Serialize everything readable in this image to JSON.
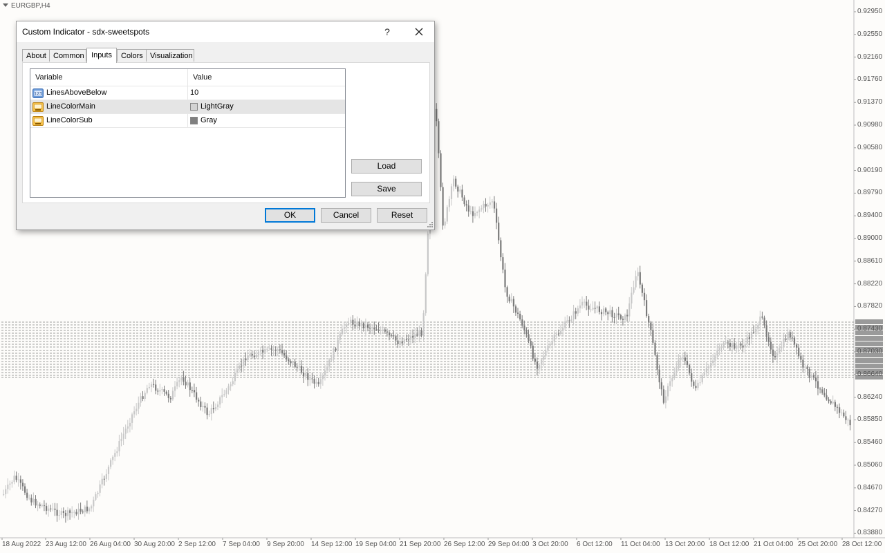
{
  "chart": {
    "symbol": "EURGBP,H4",
    "price_labels": [
      "0.92950",
      "0.92550",
      "0.92160",
      "0.91760",
      "0.91370",
      "0.90980",
      "0.90580",
      "0.90190",
      "0.89790",
      "0.89400",
      "0.89000",
      "0.88610",
      "0.88220",
      "0.87820",
      "0.87430",
      "0.87030",
      "0.86640",
      "0.86240",
      "0.85850",
      "0.85460",
      "0.85060",
      "0.84670",
      "0.84270",
      "0.83880"
    ],
    "time_labels": [
      "18 Aug 2022",
      "23 Aug 12:00",
      "26 Aug 04:00",
      "30 Aug 20:00",
      "2 Sep 12:00",
      "7 Sep 04:00",
      "9 Sep 20:00",
      "14 Sep 12:00",
      "19 Sep 04:00",
      "21 Sep 20:00",
      "26 Sep 12:00",
      "29 Sep 04:00",
      "3 Oct 20:00",
      "6 Oct 12:00",
      "11 Oct 04:00",
      "13 Oct 20:00",
      "18 Oct 12:00",
      "21 Oct 04:00",
      "25 Oct 20:00",
      "28 Oct 12:00"
    ],
    "colors": {
      "bull": "#c8c8c8",
      "bear": "#7a7a7a",
      "sweetspot_line": "#808080",
      "axis": "#bdbdbd"
    }
  },
  "dialog": {
    "title": "Custom Indicator - sdx-sweetspots",
    "help_label": "?",
    "close_icon": "close-icon",
    "tabs": [
      {
        "label": "About",
        "active": false
      },
      {
        "label": "Common",
        "active": false
      },
      {
        "label": "Inputs",
        "active": true
      },
      {
        "label": "Colors",
        "active": false
      },
      {
        "label": "Visualization",
        "active": false
      }
    ],
    "grid": {
      "headers": {
        "variable": "Variable",
        "value": "Value"
      },
      "rows": [
        {
          "variable": "LinesAboveBelow",
          "value": "10",
          "icon": "integer-icon",
          "selected": false
        },
        {
          "variable": "LineColorMain",
          "value": "LightGray",
          "icon": "color-icon",
          "swatch": "#d3d3d3",
          "selected": true
        },
        {
          "variable": "LineColorSub",
          "value": "Gray",
          "icon": "color-icon",
          "swatch": "#808080",
          "selected": false
        }
      ]
    },
    "buttons": {
      "load": "Load",
      "save": "Save",
      "ok": "OK",
      "cancel": "Cancel",
      "reset": "Reset"
    }
  }
}
